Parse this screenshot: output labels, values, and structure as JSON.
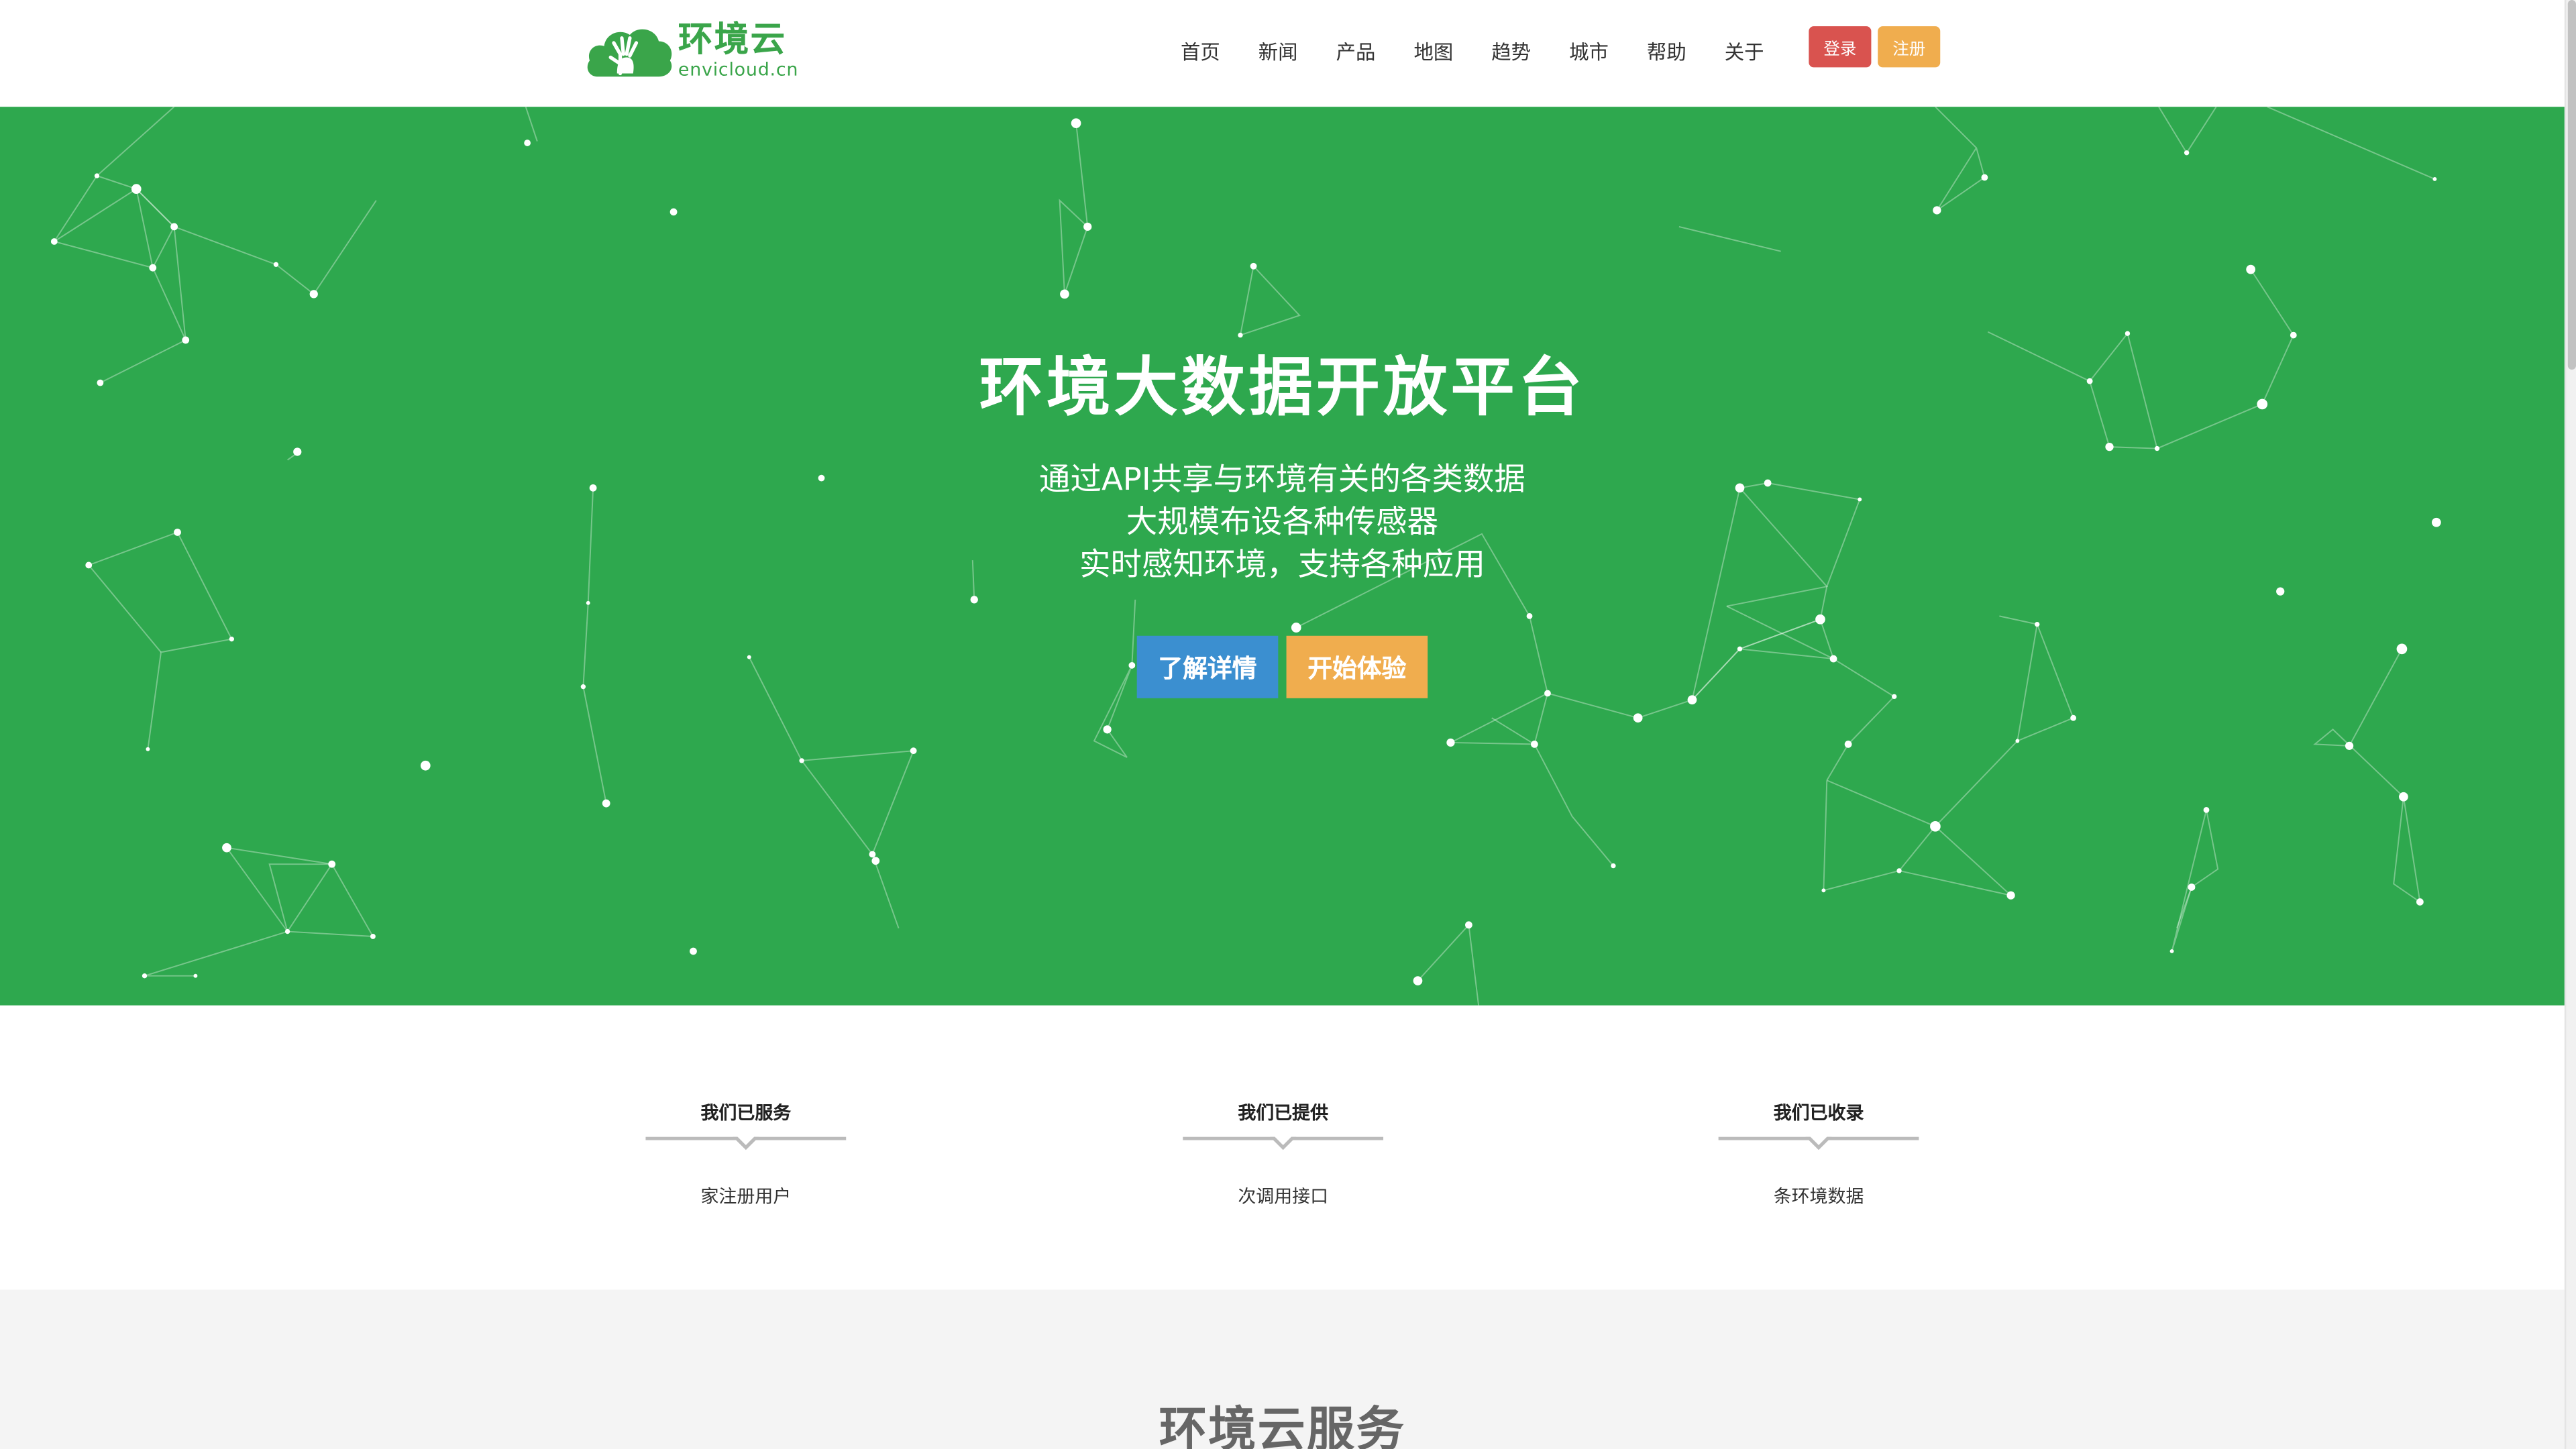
{
  "header": {
    "logo_cn": "环境云",
    "logo_en": "envicloud.cn",
    "nav": [
      "首页",
      "新闻",
      "产品",
      "地图",
      "趋势",
      "城市",
      "帮助",
      "关于"
    ],
    "login_label": "登录",
    "register_label": "注册"
  },
  "hero": {
    "title": "环境大数据开放平台",
    "lines": [
      "通过API共享与环境有关的各类数据",
      "大规模布设各种传感器",
      "实时感知环境，支持各种应用"
    ],
    "btn_details": "了解详情",
    "btn_start": "开始体验"
  },
  "stats": [
    {
      "title": "我们已服务",
      "sub": "家注册用户"
    },
    {
      "title": "我们已提供",
      "sub": "次调用接口"
    },
    {
      "title": "我们已收录",
      "sub": "条环境数据"
    }
  ],
  "services": {
    "title": "环境云服务"
  },
  "colors": {
    "brand_green": "#3aa54a",
    "hero_bg": "#2ea84e",
    "login_red": "#d9534f",
    "register_orange": "#f0ad4e",
    "details_blue": "#3b8fd0"
  }
}
